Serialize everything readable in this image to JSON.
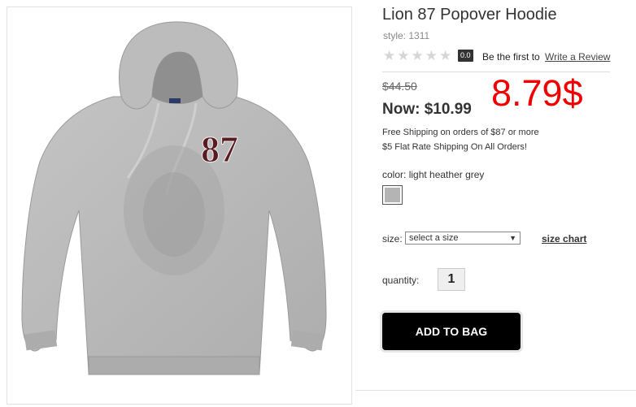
{
  "product": {
    "title": "Lion 87 Popover Hoodie",
    "style_label": "style: 1311",
    "rating": {
      "stars_filled": 0,
      "stars_total": 5,
      "score": "0.0"
    },
    "be_first_text": "Be the first to",
    "write_review_link": "Write a Review"
  },
  "price": {
    "original": "$44.50",
    "now": "Now: $10.99",
    "overlay_annotation": "8.79$"
  },
  "shipping": {
    "line1": "Free Shipping on orders of $87 or more",
    "line2": "$5 Flat Rate Shipping On All Orders!"
  },
  "color": {
    "label": "color:",
    "value": "light heather grey",
    "swatch_hex": "#b4b4b4"
  },
  "size": {
    "label": "size:",
    "selected": "select a size",
    "chart_link": "size chart"
  },
  "quantity": {
    "label": "quantity:",
    "value": "1"
  },
  "actions": {
    "add_to_bag": "ADD TO BAG"
  },
  "image": {
    "patch_text": "87",
    "colors": {
      "hoodie": "#b9b9b9",
      "patch": "#5a1a22",
      "overlay_red": "#f00000"
    }
  },
  "icons": [
    "star-icon",
    "dropdown-arrow-icon"
  ]
}
